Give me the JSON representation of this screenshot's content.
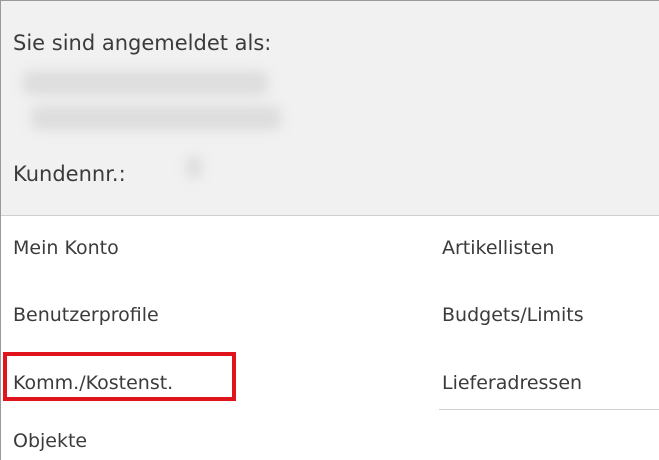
{
  "account": {
    "logged_in_label": "Sie sind angemeldet als:",
    "customer_number_label": "Kundennr.:"
  },
  "menu": {
    "left": [
      {
        "label": "Mein Konto"
      },
      {
        "label": "Benutzerprofile"
      },
      {
        "label": "Komm./Kostenst.",
        "highlighted": true
      },
      {
        "label": "Objekte"
      }
    ],
    "right": [
      {
        "label": "Artikellisten"
      },
      {
        "label": "Budgets/Limits"
      },
      {
        "label": "Lieferadressen"
      }
    ]
  },
  "colors": {
    "header_background": "#f1f1f1",
    "text": "#3b3b3b",
    "highlight_border": "#e0141c"
  }
}
